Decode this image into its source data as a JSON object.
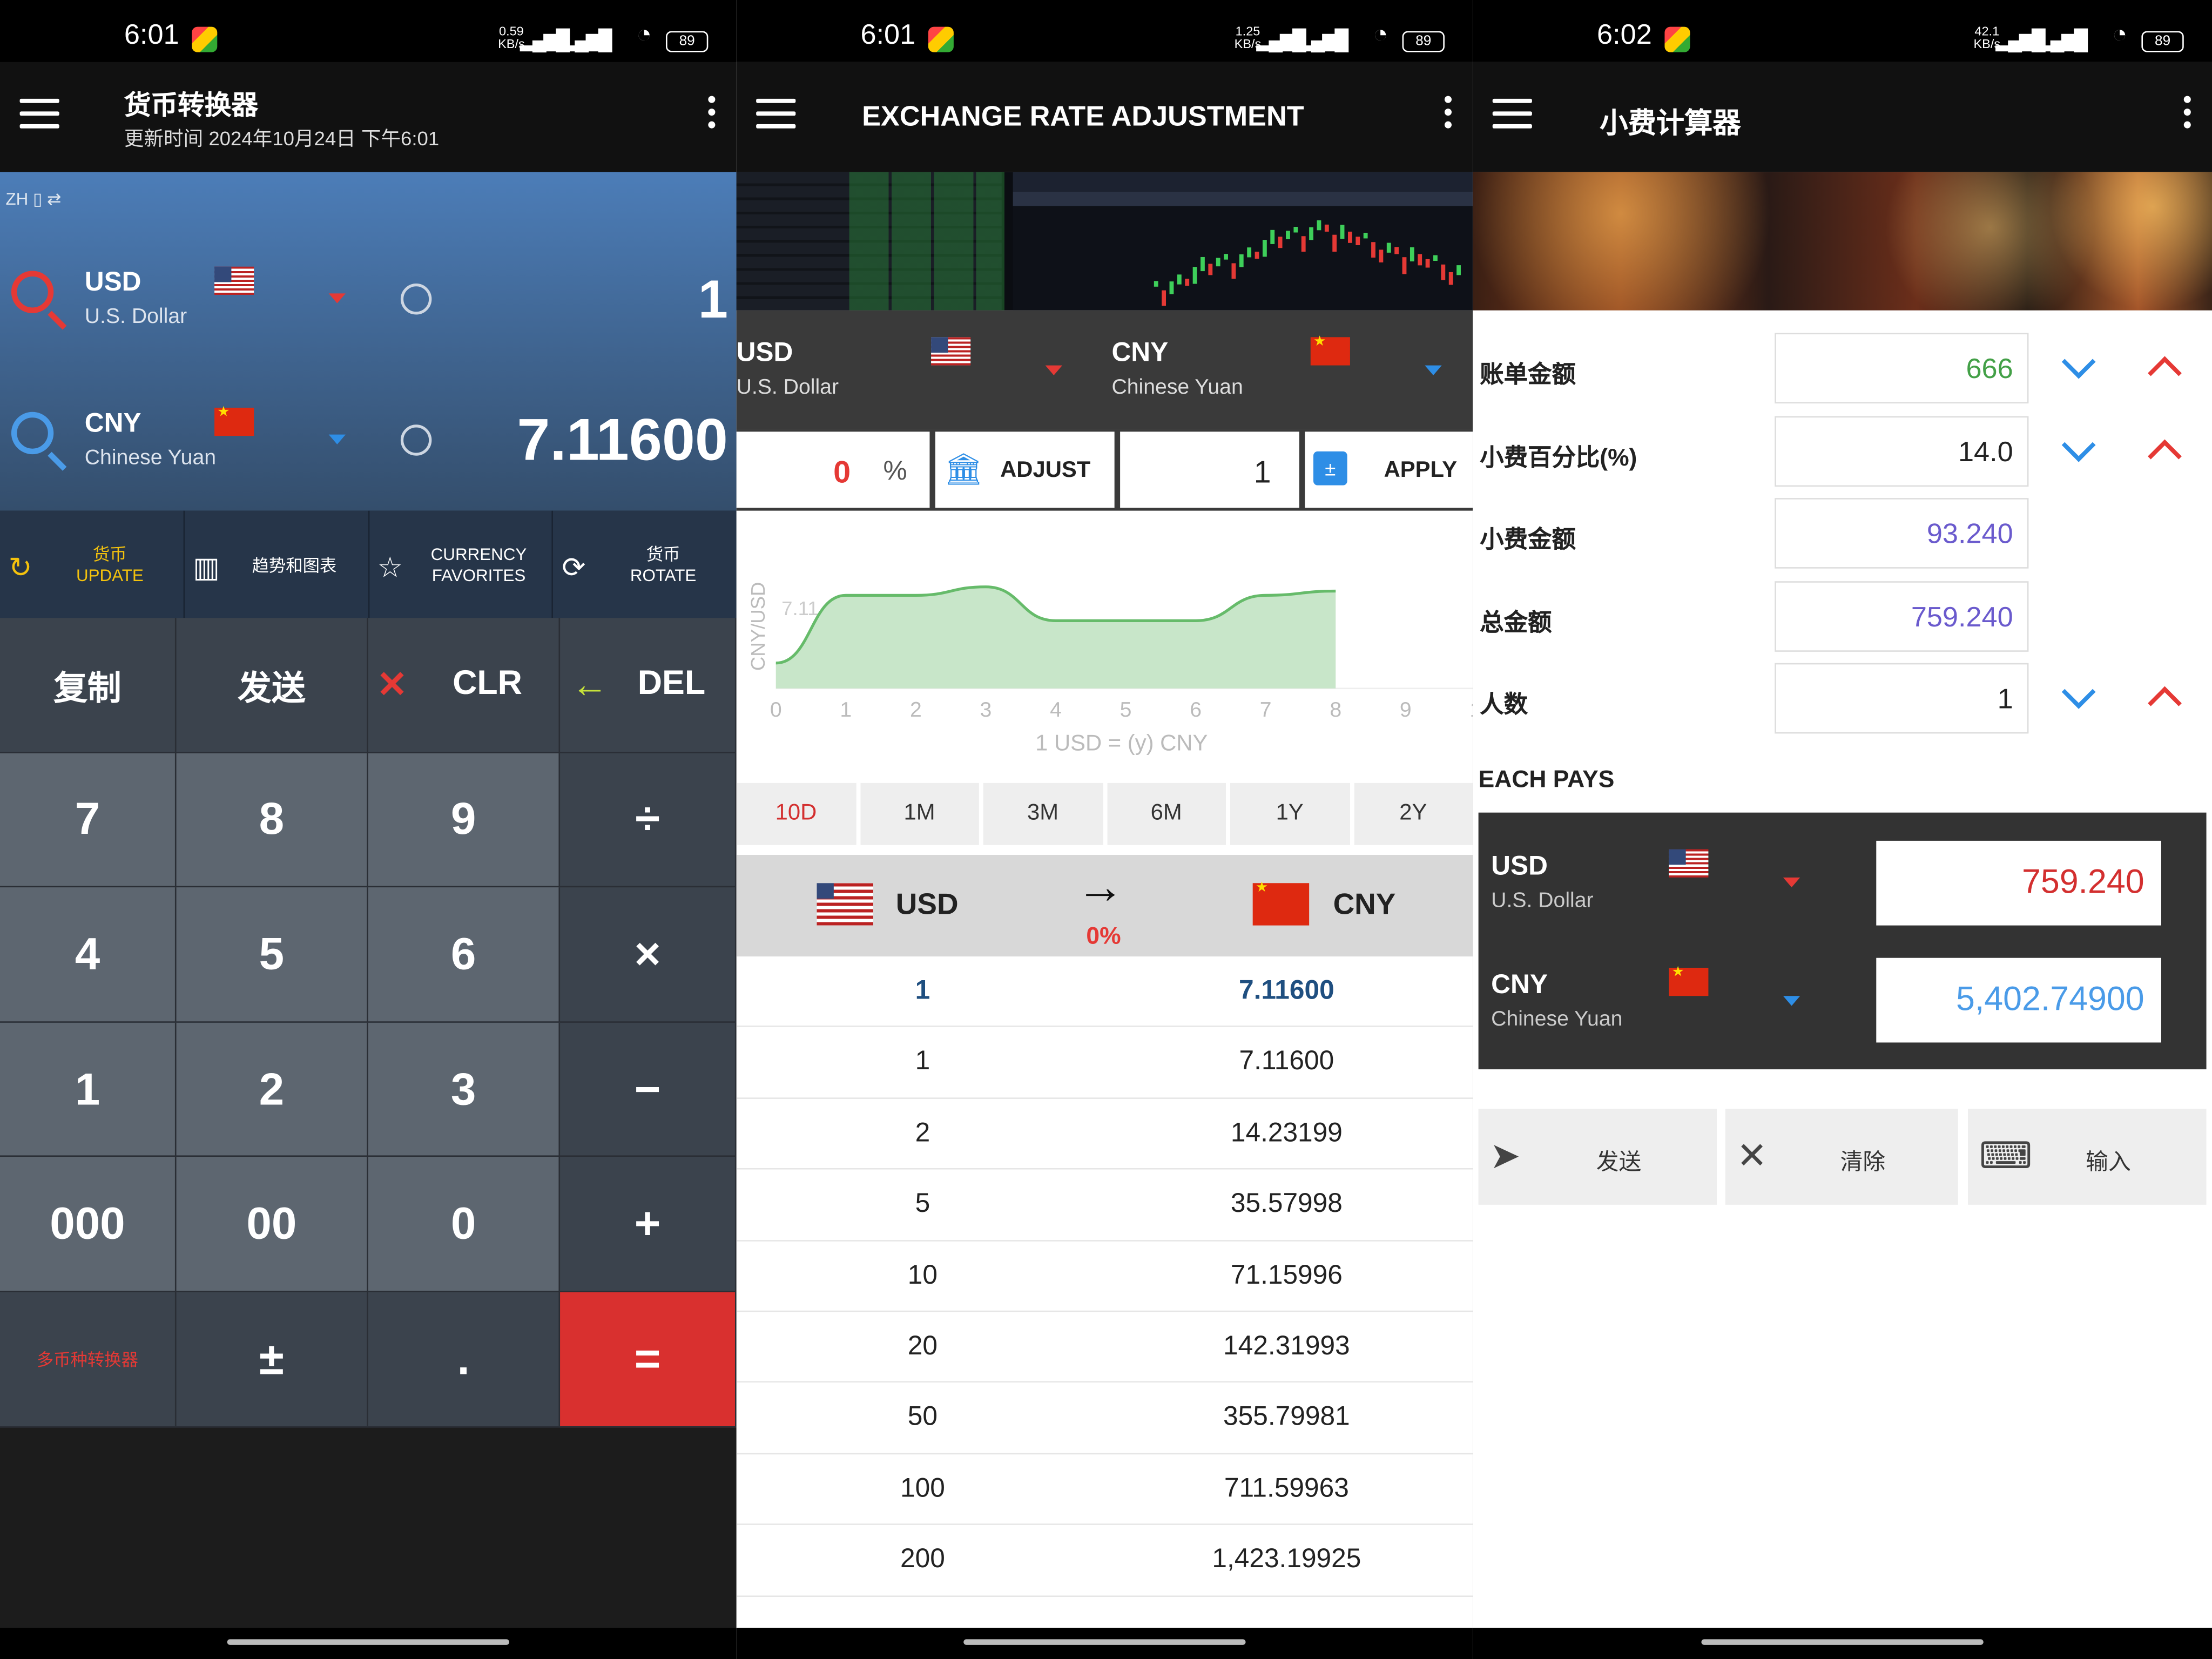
{
  "status": {
    "p1": {
      "time": "6:01",
      "net": "0.59\nKB/s",
      "battery": "89"
    },
    "p2": {
      "time": "6:01",
      "net": "1.25\nKB/s",
      "battery": "89"
    },
    "p3": {
      "time": "6:02",
      "net": "42.1\nKB/s",
      "battery": "89"
    }
  },
  "converter": {
    "title": "货币转换器",
    "updated": "更新时间 2024年10月24日 下午6:01",
    "lang": "ZH",
    "from": {
      "code": "USD",
      "name": "U.S. Dollar",
      "amount": "1"
    },
    "to": {
      "code": "CNY",
      "name": "Chinese Yuan",
      "amount": "7.11600"
    },
    "functions": [
      {
        "icon": "update-icon",
        "label": "货币\nUPDATE"
      },
      {
        "icon": "chart-icon",
        "label": "趋势和图表"
      },
      {
        "icon": "star-icon",
        "label": "CURRENCY\nFAVORITES"
      },
      {
        "icon": "rotate-icon",
        "label": "货币\nROTATE"
      }
    ],
    "keys": {
      "copy": "复制",
      "send": "发送",
      "clr": "CLR",
      "del": "DEL",
      "k7": "7",
      "k8": "8",
      "k9": "9",
      "div": "÷",
      "k4": "4",
      "k5": "5",
      "k6": "6",
      "mul": "×",
      "k1": "1",
      "k2": "2",
      "k3": "3",
      "sub": "−",
      "k000": "000",
      "k00": "00",
      "k0": "0",
      "add": "+",
      "multi": "多币种转换器",
      "pm": "±",
      "dot": ".",
      "eq": "="
    }
  },
  "adjust": {
    "title": "EXCHANGE RATE ADJUSTMENT",
    "from": {
      "code": "USD",
      "name": "U.S. Dollar"
    },
    "to": {
      "code": "CNY",
      "name": "Chinese Yuan"
    },
    "percent_value": "0",
    "percent_sign": "%",
    "adjust_label": "ADJUST",
    "amount_value": "1",
    "apply_label": "APPLY",
    "periods": [
      "10D",
      "1M",
      "3M",
      "6M",
      "1Y",
      "2Y"
    ],
    "active_period": "10D",
    "table_head": {
      "from": "USD",
      "to": "CNY",
      "pct": "0%"
    },
    "rows": [
      {
        "from": "1",
        "to": "7.11600"
      },
      {
        "from": "1",
        "to": "7.11600"
      },
      {
        "from": "2",
        "to": "14.23199"
      },
      {
        "from": "5",
        "to": "35.57998"
      },
      {
        "from": "10",
        "to": "71.15996"
      },
      {
        "from": "20",
        "to": "142.31993"
      },
      {
        "from": "50",
        "to": "355.79981"
      },
      {
        "from": "100",
        "to": "711.59963"
      },
      {
        "from": "200",
        "to": "1,423.19925"
      }
    ]
  },
  "chart_data": {
    "type": "area",
    "x": [
      0,
      1,
      2,
      3,
      4,
      5,
      6,
      7,
      8
    ],
    "values": [
      7.096,
      7.112,
      7.112,
      7.114,
      7.106,
      7.106,
      7.106,
      7.112,
      7.113
    ],
    "xticks": [
      "0",
      "1",
      "2",
      "3",
      "4",
      "5",
      "6",
      "7",
      "8",
      "9",
      "1"
    ],
    "ytick": "7.11",
    "ylabel": "CNY/USD",
    "xlabel": "1 USD  =  (y) CNY",
    "xlim": [
      0,
      10
    ],
    "fill": "#c8e6c9",
    "line": "#66bb6a"
  },
  "tip": {
    "title": "小费计算器",
    "fields": [
      {
        "label": "账单金额",
        "value": "666",
        "color": "#43a047",
        "spin": true
      },
      {
        "label": "小费百分比(%)",
        "value": "14.0",
        "color": "#222",
        "spin": true
      },
      {
        "label": "小费金额",
        "value": "93.240",
        "color": "#6a5acd",
        "spin": false
      },
      {
        "label": "总金额",
        "value": "759.240",
        "color": "#6a5acd",
        "spin": false
      },
      {
        "label": "人数",
        "value": "1",
        "color": "#222",
        "spin": true
      }
    ],
    "each_pays": "EACH PAYS",
    "pay_from": {
      "code": "USD",
      "name": "U.S. Dollar",
      "value": "759.240"
    },
    "pay_to": {
      "code": "CNY",
      "name": "Chinese Yuan",
      "value": "5,402.74900"
    },
    "buttons": {
      "send": "发送",
      "clear": "清除",
      "input": "输入"
    }
  }
}
